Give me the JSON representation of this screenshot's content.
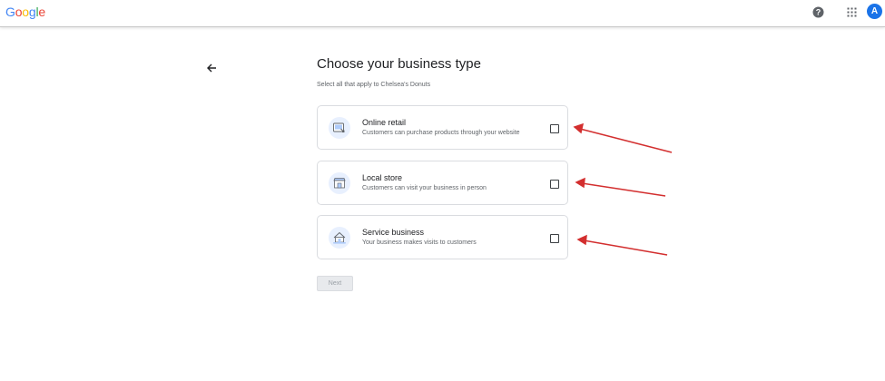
{
  "header": {
    "logo_letters": [
      "G",
      "o",
      "o",
      "g",
      "l",
      "e"
    ],
    "logo_colors": [
      "#4285F4",
      "#EA4335",
      "#FBBC05",
      "#4285F4",
      "#34A853",
      "#EA4335"
    ],
    "avatar_initial": "A",
    "avatar_color": "#1a73e8",
    "icons": [
      "help-icon",
      "apps-icon"
    ]
  },
  "page": {
    "title": "Choose your business type",
    "subtitle": "Select all that apply to Chelsea's Donuts"
  },
  "options": [
    {
      "title": "Online retail",
      "description": "Customers can purchase products through your website",
      "icon": "online-retail-icon",
      "checked": false
    },
    {
      "title": "Local store",
      "description": "Customers can visit your business in person",
      "icon": "local-store-icon",
      "checked": false
    },
    {
      "title": "Service business",
      "description": "Your business makes visits to customers",
      "icon": "service-business-icon",
      "checked": false
    }
  ],
  "next_button": {
    "label": "Next",
    "enabled": false
  },
  "annotation_color": "#d32f2f"
}
